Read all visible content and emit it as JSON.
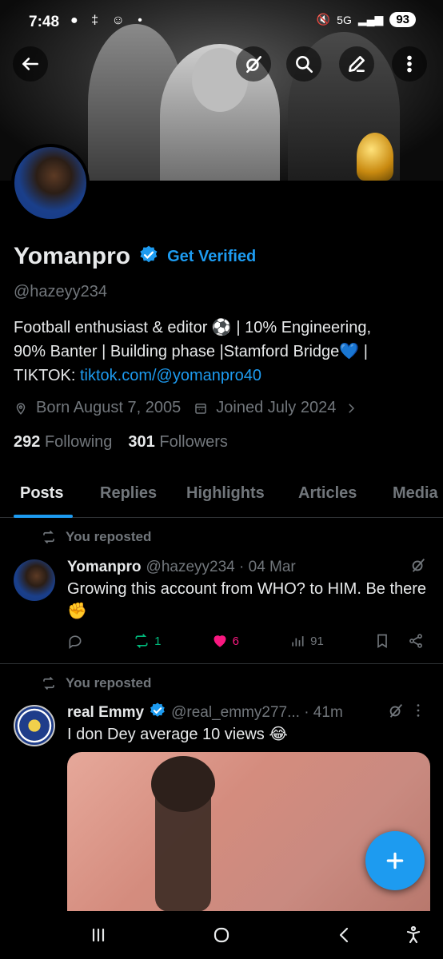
{
  "status_bar": {
    "time": "7:48",
    "left_icons": "● ‡ ☺ •",
    "network": "5G",
    "battery": "93"
  },
  "profile": {
    "display_name": "Yomanpro",
    "get_verified": "Get Verified",
    "handle": "@hazeyy234",
    "bio_line1": "Football enthusiast & editor ⚽ | 10% Engineering,",
    "bio_line2": "90% Banter | Building phase |Stamford Bridge💙 |",
    "bio_line3_prefix": "TIKTOK: ",
    "bio_link": "tiktok.com/@yomanpro40",
    "born": "Born August 7, 2005",
    "joined": "Joined July 2024",
    "following_count": "292",
    "following_label": "Following",
    "followers_count": "301",
    "followers_label": "Followers"
  },
  "tabs": [
    "Posts",
    "Replies",
    "Highlights",
    "Articles",
    "Media"
  ],
  "posts": [
    {
      "repost_label": "You reposted",
      "name": "Yomanpro",
      "meta": "@hazeyy234 · 04 Mar",
      "text": "Growing this account from WHO? to HIM. Be there✊",
      "reposts": "1",
      "likes": "6",
      "views": "91"
    },
    {
      "repost_label": "You reposted",
      "name": "real Emmy",
      "meta": "@real_emmy277...  · 41m",
      "text": "I don Dey average 10 views 😂"
    }
  ],
  "colors": {
    "accent": "#1d9bf0",
    "retweet": "#00ba7c",
    "like": "#f91880",
    "muted": "#71767b"
  }
}
